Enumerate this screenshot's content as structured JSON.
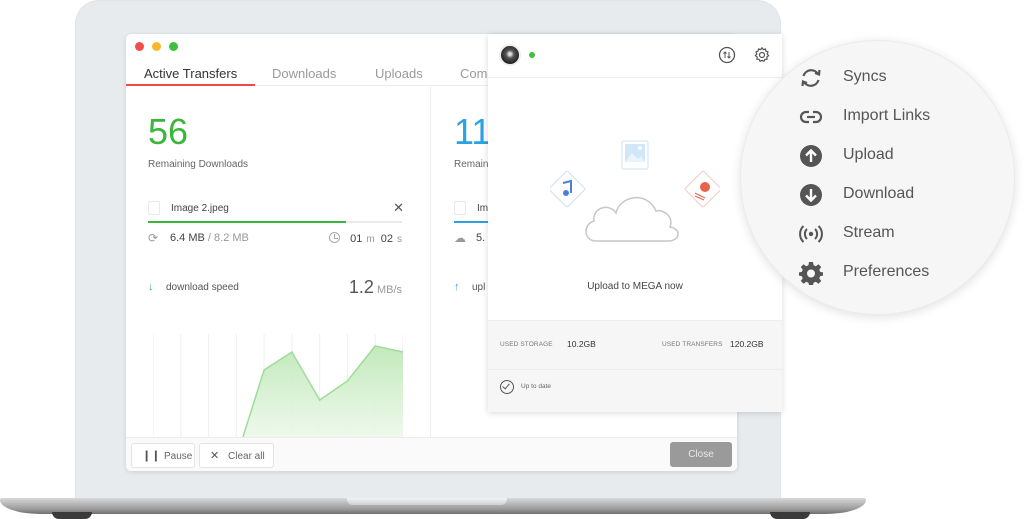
{
  "colors": {
    "accent_red": "#f0484c",
    "download_green": "#3ab73a",
    "upload_blue": "#2aa3e0",
    "traffic_red": "#f24e4e",
    "traffic_yellow": "#f6b92c",
    "traffic_green": "#3ec13e",
    "status_online": "#3ec13e",
    "chart_line": "#9fdc98",
    "chart_fill": "#c9ecc4"
  },
  "window": {
    "tabs": [
      {
        "label": "Active Transfers",
        "active": true
      },
      {
        "label": "Downloads",
        "active": false
      },
      {
        "label": "Uploads",
        "active": false
      },
      {
        "label": "Com",
        "active": false
      }
    ],
    "downloads_panel": {
      "count": "56",
      "label": "Remaining Downloads",
      "file": {
        "icon": "image-file-icon",
        "name": "Image 2.jpeg",
        "progress": 0.78,
        "transferred": "6.4 MB",
        "total": "/ 8.2 MB",
        "minutes": "01",
        "minutes_unit": "m",
        "seconds": "02",
        "seconds_unit": "s"
      },
      "speed": {
        "icon": "arrow-down-icon",
        "label": "download speed",
        "value": "1.2",
        "unit": "MB/s"
      }
    },
    "uploads_panel": {
      "count": "11",
      "label": "Remain",
      "file_name": "Im",
      "transferred": "5.",
      "progress": 0.25,
      "speed_label": "upl",
      "speed_icon": "arrow-up-icon"
    },
    "footer": {
      "pause_label": "Pause",
      "clear_label": "Clear all",
      "close_label": "Close"
    }
  },
  "chart_data": {
    "type": "area",
    "title": "download speed",
    "xlabel": "",
    "ylabel": "MB/s",
    "x": [
      1,
      2,
      3,
      4,
      5,
      6,
      7,
      8,
      9,
      10
    ],
    "values": [
      0.02,
      0.04,
      0.2,
      0.14,
      1.02,
      1.2,
      0.72,
      0.91,
      1.26,
      1.2
    ],
    "ylim": [
      0,
      1.3
    ],
    "grid": "vertical",
    "legend": "none"
  },
  "popup": {
    "status": "online",
    "cta_label": "Upload to MEGA now",
    "used_storage_label": "USED STORAGE",
    "used_storage_value": "10.2GB",
    "used_transfers_label": "USED TRANSFERS",
    "used_transfers_value": "120.2GB",
    "sync_status": "Up to date"
  },
  "menu": {
    "items": [
      {
        "label": "Syncs",
        "icon": "sync-icon"
      },
      {
        "label": "Import Links",
        "icon": "link-icon"
      },
      {
        "label": "Upload",
        "icon": "upload-icon"
      },
      {
        "label": "Download",
        "icon": "download-icon"
      },
      {
        "label": "Stream",
        "icon": "stream-icon"
      },
      {
        "label": "Preferences",
        "icon": "gear-icon"
      }
    ]
  }
}
